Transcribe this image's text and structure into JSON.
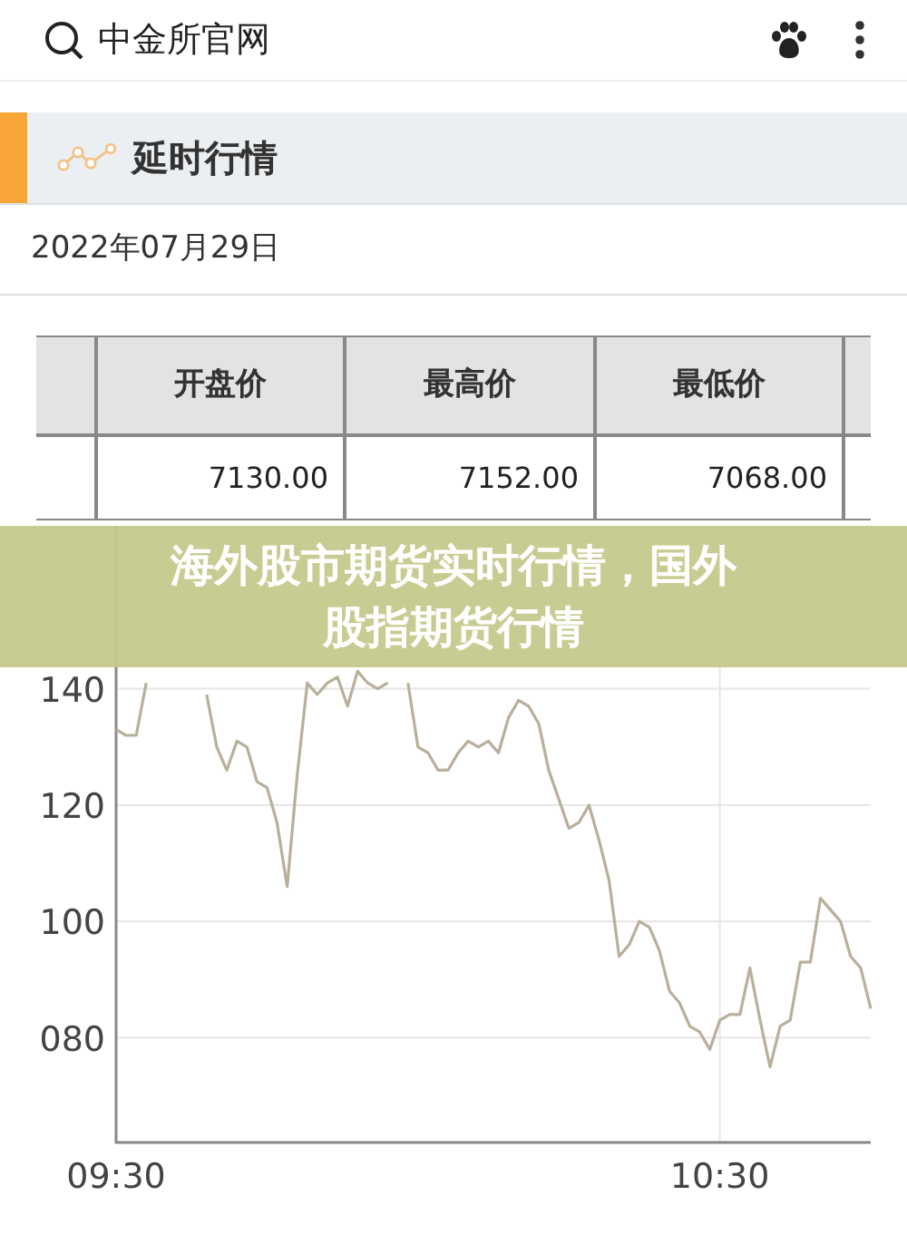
{
  "search_bar": {
    "query": "中金所官网"
  },
  "section": {
    "title": "延时行情"
  },
  "date": "2022年07月29日",
  "table": {
    "columns": [
      "开盘价",
      "最高价",
      "最低价"
    ],
    "rows": [
      [
        "7130.00",
        "7152.00",
        "7068.00"
      ]
    ]
  },
  "banner": {
    "title": "海外股市期货实时行情，国外股指期货行情"
  },
  "chart": {
    "chart_data": {
      "type": "line",
      "grid": true,
      "ylim": [
        62,
        168
      ],
      "categories": [
        "09:30",
        null,
        null,
        null,
        null,
        null,
        null,
        null,
        null,
        null,
        null,
        null,
        null,
        null,
        null,
        null,
        null,
        null,
        null,
        null,
        null,
        null,
        null,
        null,
        null,
        null,
        null,
        null,
        null,
        null,
        null,
        null,
        null,
        null,
        null,
        null,
        null,
        null,
        null,
        null,
        null,
        null,
        null,
        null,
        null,
        null,
        null,
        null,
        null,
        null,
        null,
        null,
        null,
        null,
        null,
        null,
        null,
        null,
        null,
        null,
        "10:30",
        null,
        null,
        null,
        null,
        null,
        null,
        null,
        null,
        null,
        null,
        null,
        null,
        null,
        null,
        null
      ],
      "yticks": [
        140,
        120,
        100,
        {
          "value": 80,
          "label": "080"
        }
      ],
      "series": [
        {
          "color": "#b9b09c",
          "values": [
            133,
            132,
            132,
            141,
            null,
            null,
            null,
            null,
            null,
            139,
            130,
            126,
            131,
            130,
            124,
            123,
            117,
            106,
            125,
            141,
            139,
            141,
            142,
            137,
            143,
            141,
            140,
            141,
            null,
            141,
            130,
            129,
            126,
            126,
            129,
            131,
            130,
            131,
            129,
            135,
            138,
            137,
            134,
            126,
            121,
            116,
            117,
            120,
            114,
            107,
            94,
            96,
            100,
            99,
            95,
            88,
            86,
            82,
            81,
            78,
            83,
            84,
            84,
            92,
            83,
            75,
            82,
            83,
            93,
            93,
            104,
            102,
            100,
            94,
            92,
            85
          ]
        }
      ]
    }
  }
}
